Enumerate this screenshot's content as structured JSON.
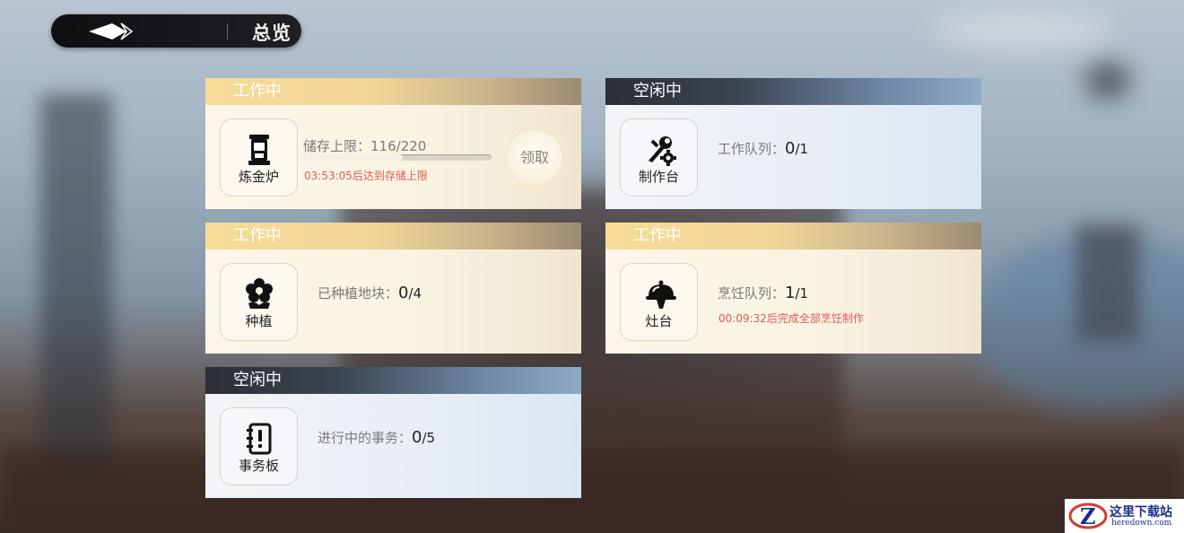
{
  "topbar": {
    "title": "总览"
  },
  "cards": {
    "alchemy": {
      "status": "工作中",
      "name": "炼金炉",
      "stat_label": "储存上限：",
      "stat_value": "116/220",
      "progress": 0.527,
      "warning": "03:53:05后达到存储上限",
      "claim_label": "领取"
    },
    "workbench": {
      "status": "空闲中",
      "name": "制作台",
      "stat_label": "工作队列：",
      "stat_num": "0",
      "stat_den": "/1"
    },
    "planting": {
      "status": "工作中",
      "name": "种植",
      "stat_label": "已种植地块：",
      "stat_num": "0",
      "stat_den": "/4"
    },
    "stove": {
      "status": "工作中",
      "name": "灶台",
      "stat_label": "烹饪队列：",
      "stat_num": "1",
      "stat_den": "/1",
      "warning": "00:09:32后完成全部烹饪制作"
    },
    "board": {
      "status": "空闲中",
      "name": "事务板",
      "stat_label": "进行中的事务：",
      "stat_num": "0",
      "stat_den": "/5"
    }
  },
  "watermark": {
    "cn": "这里下载站",
    "en": "heredown.com"
  },
  "colors": {
    "working_header": "#f6dc97",
    "idle_header": "#3b4552",
    "warning": "#e05a55"
  }
}
